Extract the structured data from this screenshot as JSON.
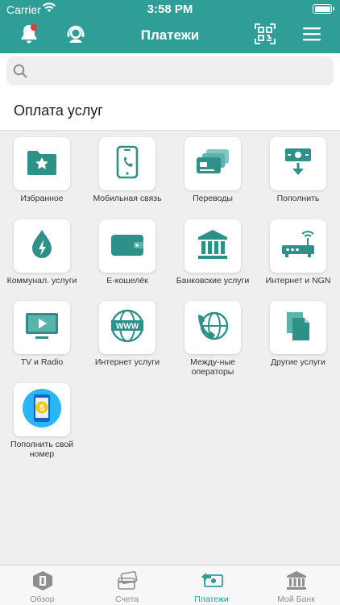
{
  "status_bar": {
    "carrier": "Carrier",
    "time": "3:58 PM"
  },
  "header": {
    "title": "Платежи",
    "has_notification_dot": true
  },
  "search": {
    "placeholder": ""
  },
  "section": {
    "title": "Оплата услуг"
  },
  "services": [
    {
      "label": "Избранное",
      "icon": "favorites-folder-icon"
    },
    {
      "label": "Мобильная связь",
      "icon": "mobile-phone-icon"
    },
    {
      "label": "Переводы",
      "icon": "transfer-cards-icon"
    },
    {
      "label": "Пополнить",
      "icon": "top-up-icon"
    },
    {
      "label": "Коммунал. услуги",
      "icon": "utility-drop-icon"
    },
    {
      "label": "E-кошелёк",
      "icon": "wallet-icon"
    },
    {
      "label": "Банковские услуги",
      "icon": "bank-icon"
    },
    {
      "label": "Интернет и NGN",
      "icon": "router-icon"
    },
    {
      "label": "TV и Radio",
      "icon": "tv-icon"
    },
    {
      "label": "Интернет услуги",
      "icon": "www-globe-icon"
    },
    {
      "label": "Между-ные операторы",
      "icon": "international-call-icon"
    },
    {
      "label": "Другие услуги",
      "icon": "documents-icon"
    },
    {
      "label": "Пополнить свой номер",
      "icon": "top-up-own-number-icon"
    }
  ],
  "tabs": [
    {
      "label": "Обзор",
      "icon": "overview-icon",
      "active": false
    },
    {
      "label": "Счета",
      "icon": "accounts-icon",
      "active": false
    },
    {
      "label": "Платежи",
      "icon": "payments-icon",
      "active": true
    },
    {
      "label": "Мой Банк",
      "icon": "my-bank-icon",
      "active": false
    }
  ],
  "colors": {
    "brand": "#2f9e96",
    "notification": "#e53935",
    "tab_active": "#2f9e96",
    "tab_inactive": "#8e8e8e",
    "coin": "#f5c518",
    "phone_circle": "#29b6f6"
  }
}
